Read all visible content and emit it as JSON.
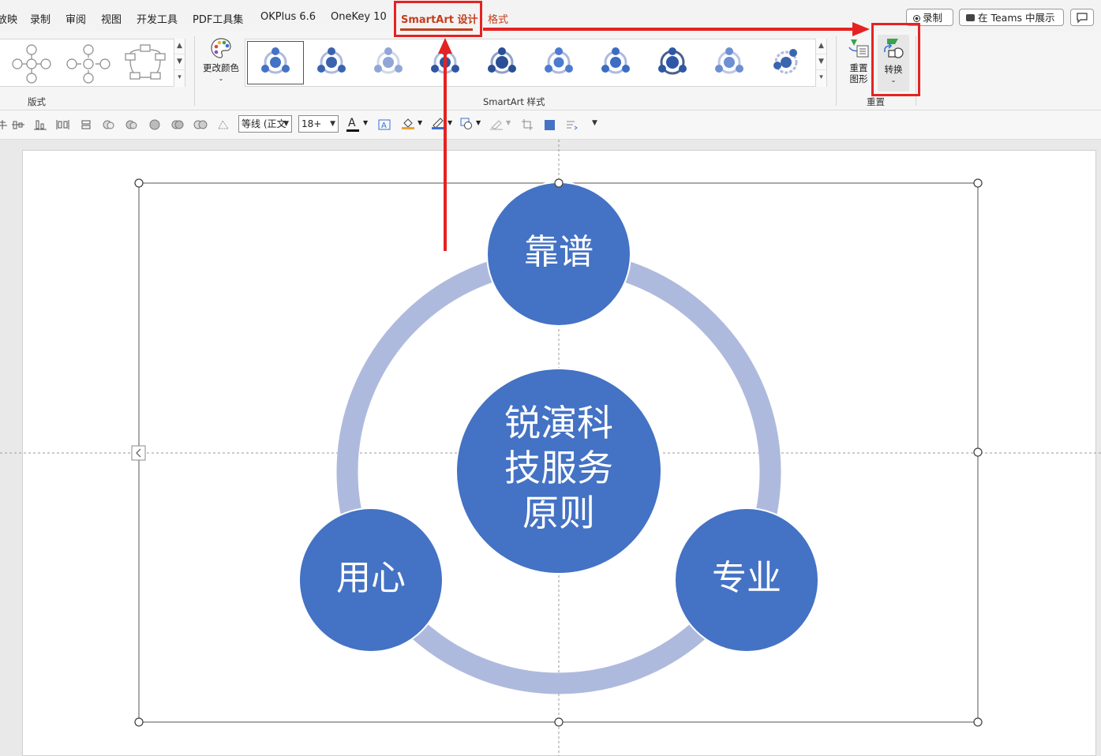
{
  "tabs": {
    "slideshow": "放映",
    "record": "录制",
    "review": "审阅",
    "view": "视图",
    "developer": "开发工具",
    "pdf_tools": "PDF工具集",
    "okplus": "OKPlus 6.6",
    "onekey": "OneKey 10",
    "smartart_design": "SmartArt 设计",
    "format": "格式"
  },
  "top_buttons": {
    "record": "录制",
    "teams": "在 Teams 中展示"
  },
  "ribbon": {
    "layouts_label": "版式",
    "change_colors_label": "更改颜色",
    "styles_label": "SmartArt 样式",
    "reset_graphic_label_line1": "重置",
    "reset_graphic_label_line2": "图形",
    "convert_label": "转换",
    "reset_group_label": "重置"
  },
  "format_bar": {
    "font_name": "等线 (正文",
    "font_size": "18+"
  },
  "smartart": {
    "center": [
      "锐演科",
      "技服务",
      "原则"
    ],
    "top": "靠谱",
    "left": "用心",
    "right": "专业"
  },
  "colors": {
    "accent_red": "#c43e1c",
    "annotation_red": "#e52222",
    "node_fill": "#4472c4",
    "ring_fill": "#aebadd"
  }
}
